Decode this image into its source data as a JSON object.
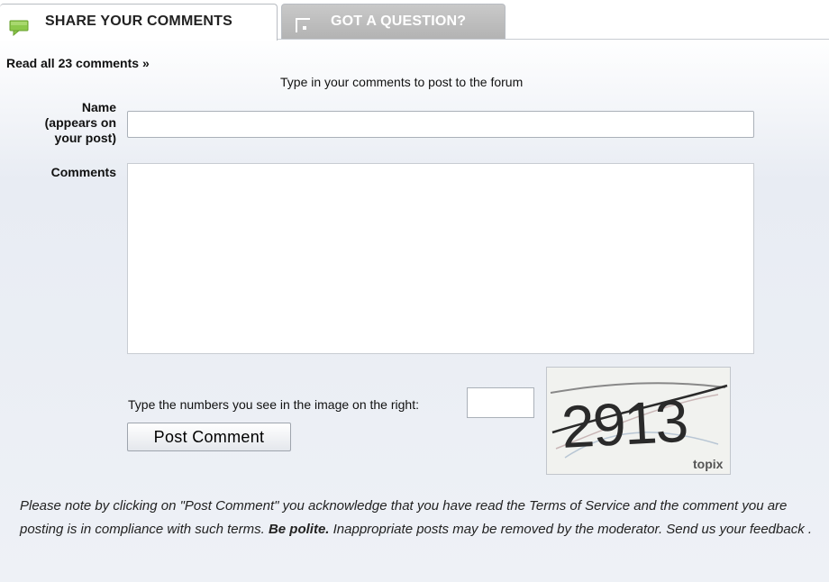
{
  "tabs": {
    "share_label": "SHARE YOUR COMMENTS",
    "question_label": "GOT A QUESTION?"
  },
  "read_all_link": "Read all 23 comments »",
  "instructions": "Type in your comments to post to the forum",
  "form": {
    "name_label_line1": "Name",
    "name_label_line2": "(appears on",
    "name_label_line3": "your post)",
    "name_value": "",
    "comments_label": "Comments",
    "comments_value": "",
    "captcha_prompt": "Type the numbers you see in the image on the right:",
    "captcha_value": "",
    "post_button": "Post Comment"
  },
  "captcha": {
    "digits": "2913",
    "brand": "topix"
  },
  "notice": {
    "part1": "Please note by clicking on \"Post Comment\" you acknowledge that you have read the Terms of Service and the comment you are posting is in compliance with such terms. ",
    "polite": "Be polite.",
    "part2": " Inappropriate posts may be removed by the moderator. Send us your feedback ."
  },
  "colors": {
    "bubble_icon": "#7fbf3f",
    "inactive_tab": "#bdbdbd"
  }
}
